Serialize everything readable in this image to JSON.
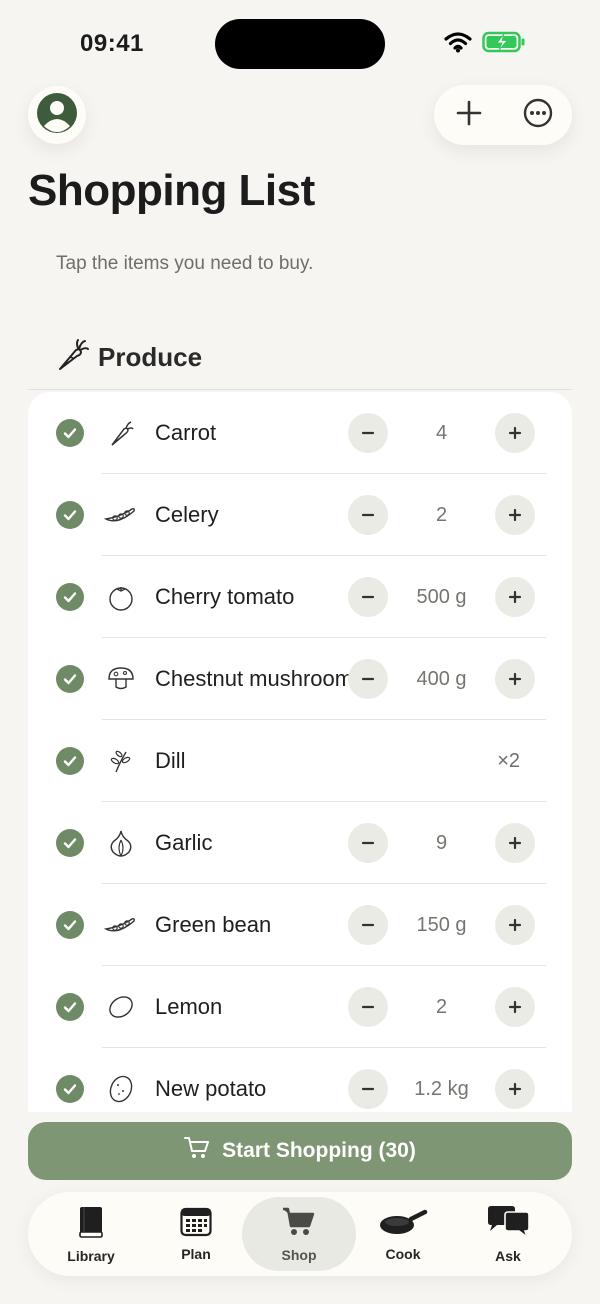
{
  "status_bar": {
    "time": "09:41"
  },
  "header": {
    "profile_icon": "person-circle-icon",
    "add_icon": "plus-icon",
    "more_icon": "ellipsis-circle-icon"
  },
  "page": {
    "title": "Shopping List",
    "subtitle": "Tap the items you need to buy."
  },
  "section": {
    "title": "Produce",
    "icon": "carrot-icon"
  },
  "items": [
    {
      "name": "Carrot",
      "icon": "carrot-icon",
      "quantity": "4",
      "checked": true
    },
    {
      "name": "Celery",
      "icon": "pea-pod-icon",
      "quantity": "2",
      "checked": true
    },
    {
      "name": "Cherry tomato",
      "icon": "tomato-icon",
      "quantity": "500 g",
      "checked": true
    },
    {
      "name": "Chestnut mushroom",
      "icon": "mushroom-icon",
      "quantity": "400 g",
      "checked": true
    },
    {
      "name": "Dill",
      "icon": "herb-sprig-icon",
      "multiplier": "×2",
      "checked": true
    },
    {
      "name": "Garlic",
      "icon": "garlic-icon",
      "quantity": "9",
      "checked": true
    },
    {
      "name": "Green bean",
      "icon": "pea-pod-icon",
      "quantity": "150 g",
      "checked": true
    },
    {
      "name": "Lemon",
      "icon": "lemon-icon",
      "quantity": "2",
      "checked": true
    },
    {
      "name": "New potato",
      "icon": "potato-icon",
      "quantity": "1.2 kg",
      "checked": true
    }
  ],
  "start_button": {
    "label": "Start Shopping (30)",
    "icon": "cart-icon"
  },
  "tabs": [
    {
      "label": "Library",
      "icon": "book-icon",
      "active": false
    },
    {
      "label": "Plan",
      "icon": "calendar-icon",
      "active": false
    },
    {
      "label": "Shop",
      "icon": "cart-icon",
      "active": true
    },
    {
      "label": "Cook",
      "icon": "pan-icon",
      "active": false
    },
    {
      "label": "Ask",
      "icon": "chat-bubbles-icon",
      "active": false
    }
  ],
  "colors": {
    "background": "#f6f5f1",
    "accent_green": "#7e9673",
    "check_green": "#6f8a66",
    "stepper_bg": "#e9ebe4",
    "battery_green": "#34c759"
  }
}
